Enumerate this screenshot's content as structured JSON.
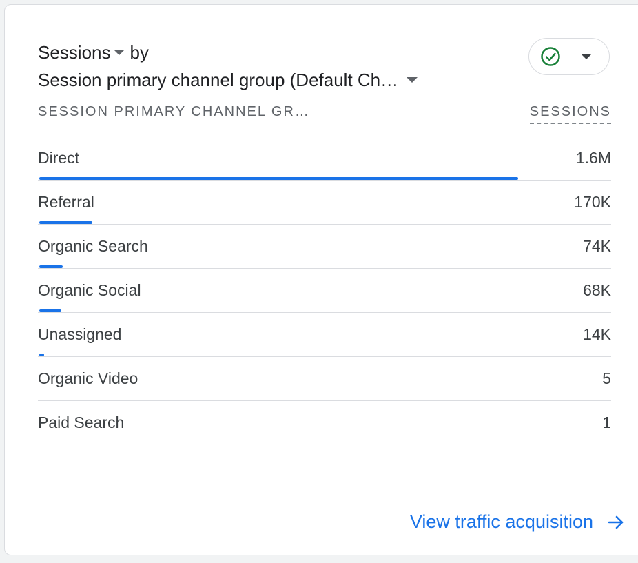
{
  "card": {
    "metric_label": "Sessions",
    "by_label": "by",
    "dimension_label": "Session primary channel group (Default Ch…",
    "status_icon": "check-circle-icon",
    "status_color": "#188038"
  },
  "table": {
    "dimension_header": "SESSION PRIMARY CHANNEL GR…",
    "metric_header": "SESSIONS",
    "bar_color": "#1a73e8",
    "rows": [
      {
        "label": "Direct",
        "value": "1.6M",
        "bar_fraction": 0.835
      },
      {
        "label": "Referral",
        "value": "170K",
        "bar_fraction": 0.093
      },
      {
        "label": "Organic Search",
        "value": "74K",
        "bar_fraction": 0.041
      },
      {
        "label": "Organic Social",
        "value": "68K",
        "bar_fraction": 0.038
      },
      {
        "label": "Unassigned",
        "value": "14K",
        "bar_fraction": 0.008
      },
      {
        "label": "Organic Video",
        "value": "5",
        "bar_fraction": 0
      },
      {
        "label": "Paid Search",
        "value": "1",
        "bar_fraction": 0
      }
    ]
  },
  "footer": {
    "link_label": "View traffic acquisition",
    "link_icon": "arrow-right-icon"
  }
}
